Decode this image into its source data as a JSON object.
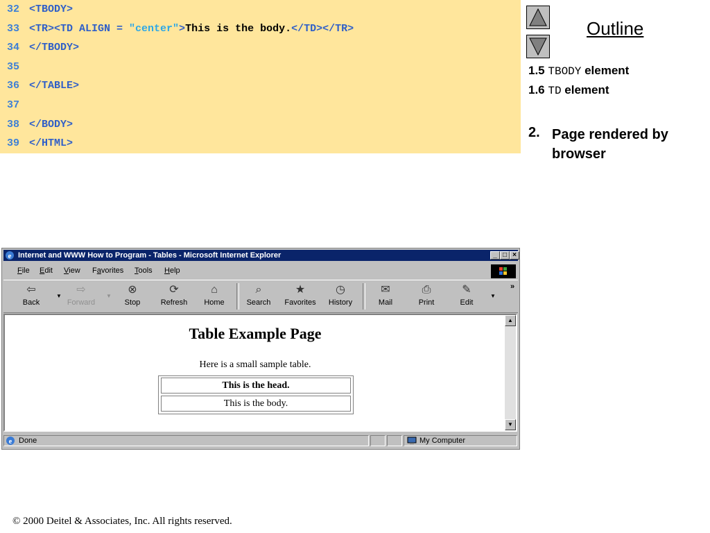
{
  "code": {
    "lines": [
      {
        "num": "32",
        "parts": [
          {
            "t": "<TBODY>",
            "c": "tag"
          }
        ]
      },
      {
        "num": "33",
        "parts": [
          {
            "t": "<TR><TD ALIGN = ",
            "c": "tag"
          },
          {
            "t": "\"center\"",
            "c": "str"
          },
          {
            "t": ">",
            "c": "tag"
          },
          {
            "t": "This is the body.",
            "c": "txt"
          },
          {
            "t": "</TD></TR>",
            "c": "tag"
          }
        ]
      },
      {
        "num": "34",
        "parts": [
          {
            "t": "</TBODY>",
            "c": "tag"
          }
        ]
      },
      {
        "num": "35",
        "parts": []
      },
      {
        "num": "36",
        "parts": [
          {
            "t": "</TABLE>",
            "c": "tag"
          }
        ]
      },
      {
        "num": "37",
        "parts": []
      },
      {
        "num": "38",
        "parts": [
          {
            "t": "</BODY>",
            "c": "tag"
          }
        ]
      },
      {
        "num": "39",
        "parts": [
          {
            "t": "</HTML>",
            "c": "tag"
          }
        ]
      }
    ]
  },
  "outline": {
    "title": "Outline",
    "item1_prefix": "1.5 ",
    "item1_code": "TBODY",
    "item1_suffix": " element",
    "item2_prefix": "1.6 ",
    "item2_code": "TD",
    "item2_suffix": " element",
    "item3_num": "2.",
    "item3_text": "Page rendered by browser"
  },
  "browser": {
    "title": "Internet and WWW How to Program - Tables - Microsoft Internet Explorer",
    "menu": [
      {
        "pre": "",
        "u": "F",
        "post": "ile"
      },
      {
        "pre": "",
        "u": "E",
        "post": "dit"
      },
      {
        "pre": "",
        "u": "V",
        "post": "iew"
      },
      {
        "pre": "F",
        "u": "a",
        "post": "vorites"
      },
      {
        "pre": "",
        "u": "T",
        "post": "ools"
      },
      {
        "pre": "",
        "u": "H",
        "post": "elp"
      }
    ],
    "toolbar": {
      "back": "Back",
      "forward": "Forward",
      "stop": "Stop",
      "refresh": "Refresh",
      "home": "Home",
      "search": "Search",
      "favorites": "Favorites",
      "history": "History",
      "mail": "Mail",
      "print": "Print",
      "edit": "Edit",
      "more": "»"
    },
    "page": {
      "heading": "Table Example Page",
      "caption": "Here is a small sample table.",
      "head_cell": "This is the head.",
      "body_cell": "This is the body."
    },
    "status": {
      "left": "Done",
      "zone": "My Computer"
    }
  },
  "footer": "© 2000 Deitel & Associates, Inc.  All rights reserved."
}
